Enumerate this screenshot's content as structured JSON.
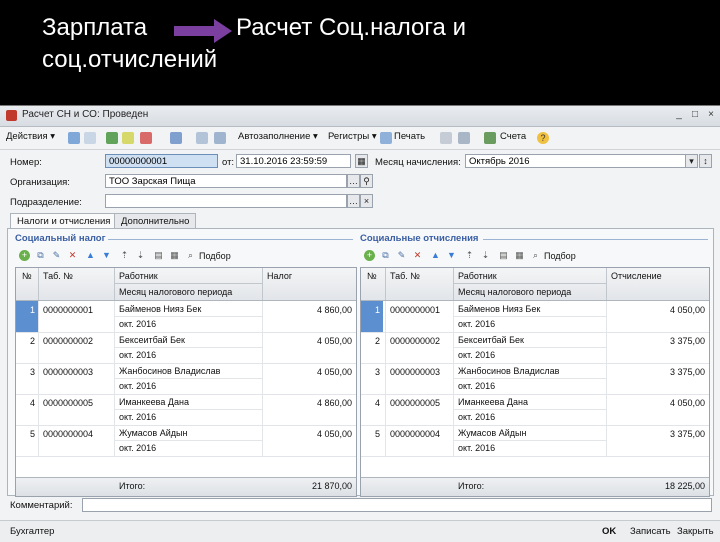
{
  "slide": {
    "title_part1": "Зарплата",
    "title_part2": "Расчет Соц.налога и",
    "title_line2": "соц.отчислений",
    "arrow_color": "#7b3fa0"
  },
  "window": {
    "title": "Расчет СН и СО: Проведен",
    "controls": [
      "_",
      "□",
      "×"
    ]
  },
  "toolbar": {
    "actions": "Действия ▾",
    "fill": "Автозаполнение ▾",
    "registers": "Регистры ▾",
    "print": "Печать",
    "accounts": "Счета",
    "help": "?"
  },
  "form": {
    "number_label": "Номер:",
    "number_value": "00000000001",
    "from_label": "от:",
    "date_value": "31.10.2016 23:59:59",
    "month_label": "Месяц начисления:",
    "month_value": "Октябрь 2016",
    "org_label": "Организация:",
    "org_value": "ТОО Зарская Пища",
    "dept_label": "Подразделение:",
    "dept_value": ""
  },
  "tabs": [
    {
      "label": "Налоги и отчисления"
    },
    {
      "label": "Дополнительно"
    }
  ],
  "left": {
    "section_title": "Социальный налог",
    "pick_label": "Подбор",
    "headers": {
      "num": "№",
      "tab": "Таб. №",
      "employee": "Работник",
      "amount": "Налог",
      "period": "Месяц налогового периода"
    },
    "rows": [
      {
        "num": "1",
        "tab": "0000000001",
        "name": "Байменов Нияз Бек",
        "period": "окт. 2016",
        "amount": "4 860,00"
      },
      {
        "num": "2",
        "tab": "0000000002",
        "name": "Бексеитбай Бек",
        "period": "окт. 2016",
        "amount": "4 050,00"
      },
      {
        "num": "3",
        "tab": "0000000003",
        "name": "Жанбосинов Владислав",
        "period": "окт. 2016",
        "amount": "4 050,00"
      },
      {
        "num": "4",
        "tab": "0000000005",
        "name": "Иманкеева Дана",
        "period": "окт. 2016",
        "amount": "4 860,00"
      },
      {
        "num": "5",
        "tab": "0000000004",
        "name": "Жумасов Айдын",
        "period": "окт. 2016",
        "amount": "4 050,00"
      }
    ],
    "total_label": "Итого:",
    "total_value": "21 870,00"
  },
  "right": {
    "section_title": "Социальные отчисления",
    "pick_label": "Подбор",
    "headers": {
      "num": "№",
      "tab": "Таб. №",
      "employee": "Работник",
      "amount": "Отчисление",
      "period": "Месяц налогового периода"
    },
    "rows": [
      {
        "num": "1",
        "tab": "0000000001",
        "name": "Байменов Нияз Бек",
        "period": "окт. 2016",
        "amount": "4 050,00"
      },
      {
        "num": "2",
        "tab": "0000000002",
        "name": "Бексеитбай Бек",
        "period": "окт. 2016",
        "amount": "3 375,00"
      },
      {
        "num": "3",
        "tab": "0000000003",
        "name": "Жанбосинов Владислав",
        "period": "окт. 2016",
        "amount": "3 375,00"
      },
      {
        "num": "4",
        "tab": "0000000005",
        "name": "Иманкеева Дана",
        "period": "окт. 2016",
        "amount": "4 050,00"
      },
      {
        "num": "5",
        "tab": "0000000004",
        "name": "Жумасов Айдын",
        "period": "окт. 2016",
        "amount": "3 375,00"
      }
    ],
    "total_label": "Итого:",
    "total_value": "18 225,00"
  },
  "comment_label": "Комментарий:",
  "bottom": {
    "responsible": "Бухгалтер",
    "ok": "OK",
    "save": "Записать",
    "close": "Закрыть"
  }
}
